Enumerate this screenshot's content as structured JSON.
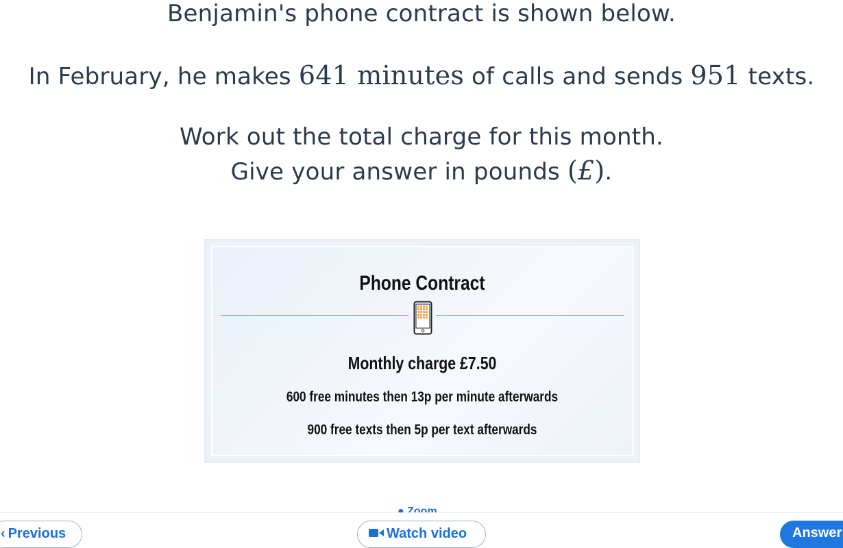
{
  "question": {
    "line1": "Benjamin's phone contract is shown below.",
    "line2_before": "In February, he makes ",
    "line2_minutes_value": "641",
    "line2_minutes_unit": "minutes",
    "line2_middle": " of calls and sends ",
    "line2_texts_value": "951",
    "line2_after": " texts.",
    "line3": "Work out the total charge for this month.",
    "line4_before": "Give your answer in pounds ",
    "line4_open": "(",
    "line4_symbol": "£",
    "line4_close": ")",
    "line4_end": "."
  },
  "contract_card": {
    "title": "Phone Contract",
    "icon": "smartphone-icon",
    "monthly_charge": "Monthly charge £7.50",
    "minutes_rule": "600 free minutes then 13p per minute afterwards",
    "texts_rule": "900 free texts then 5p per text afterwards",
    "accent_color": "#f0a348"
  },
  "footer": {
    "zoom_label": "Zoom",
    "previous_label": "Previous",
    "previous_icon": "chevron-left-icon",
    "watch_video_label": "Watch video",
    "watch_video_icon": "video-camera-icon",
    "answer_label": "Answer"
  },
  "colors": {
    "primary_blue": "#1f78e0",
    "text": "#2b3a4d"
  }
}
